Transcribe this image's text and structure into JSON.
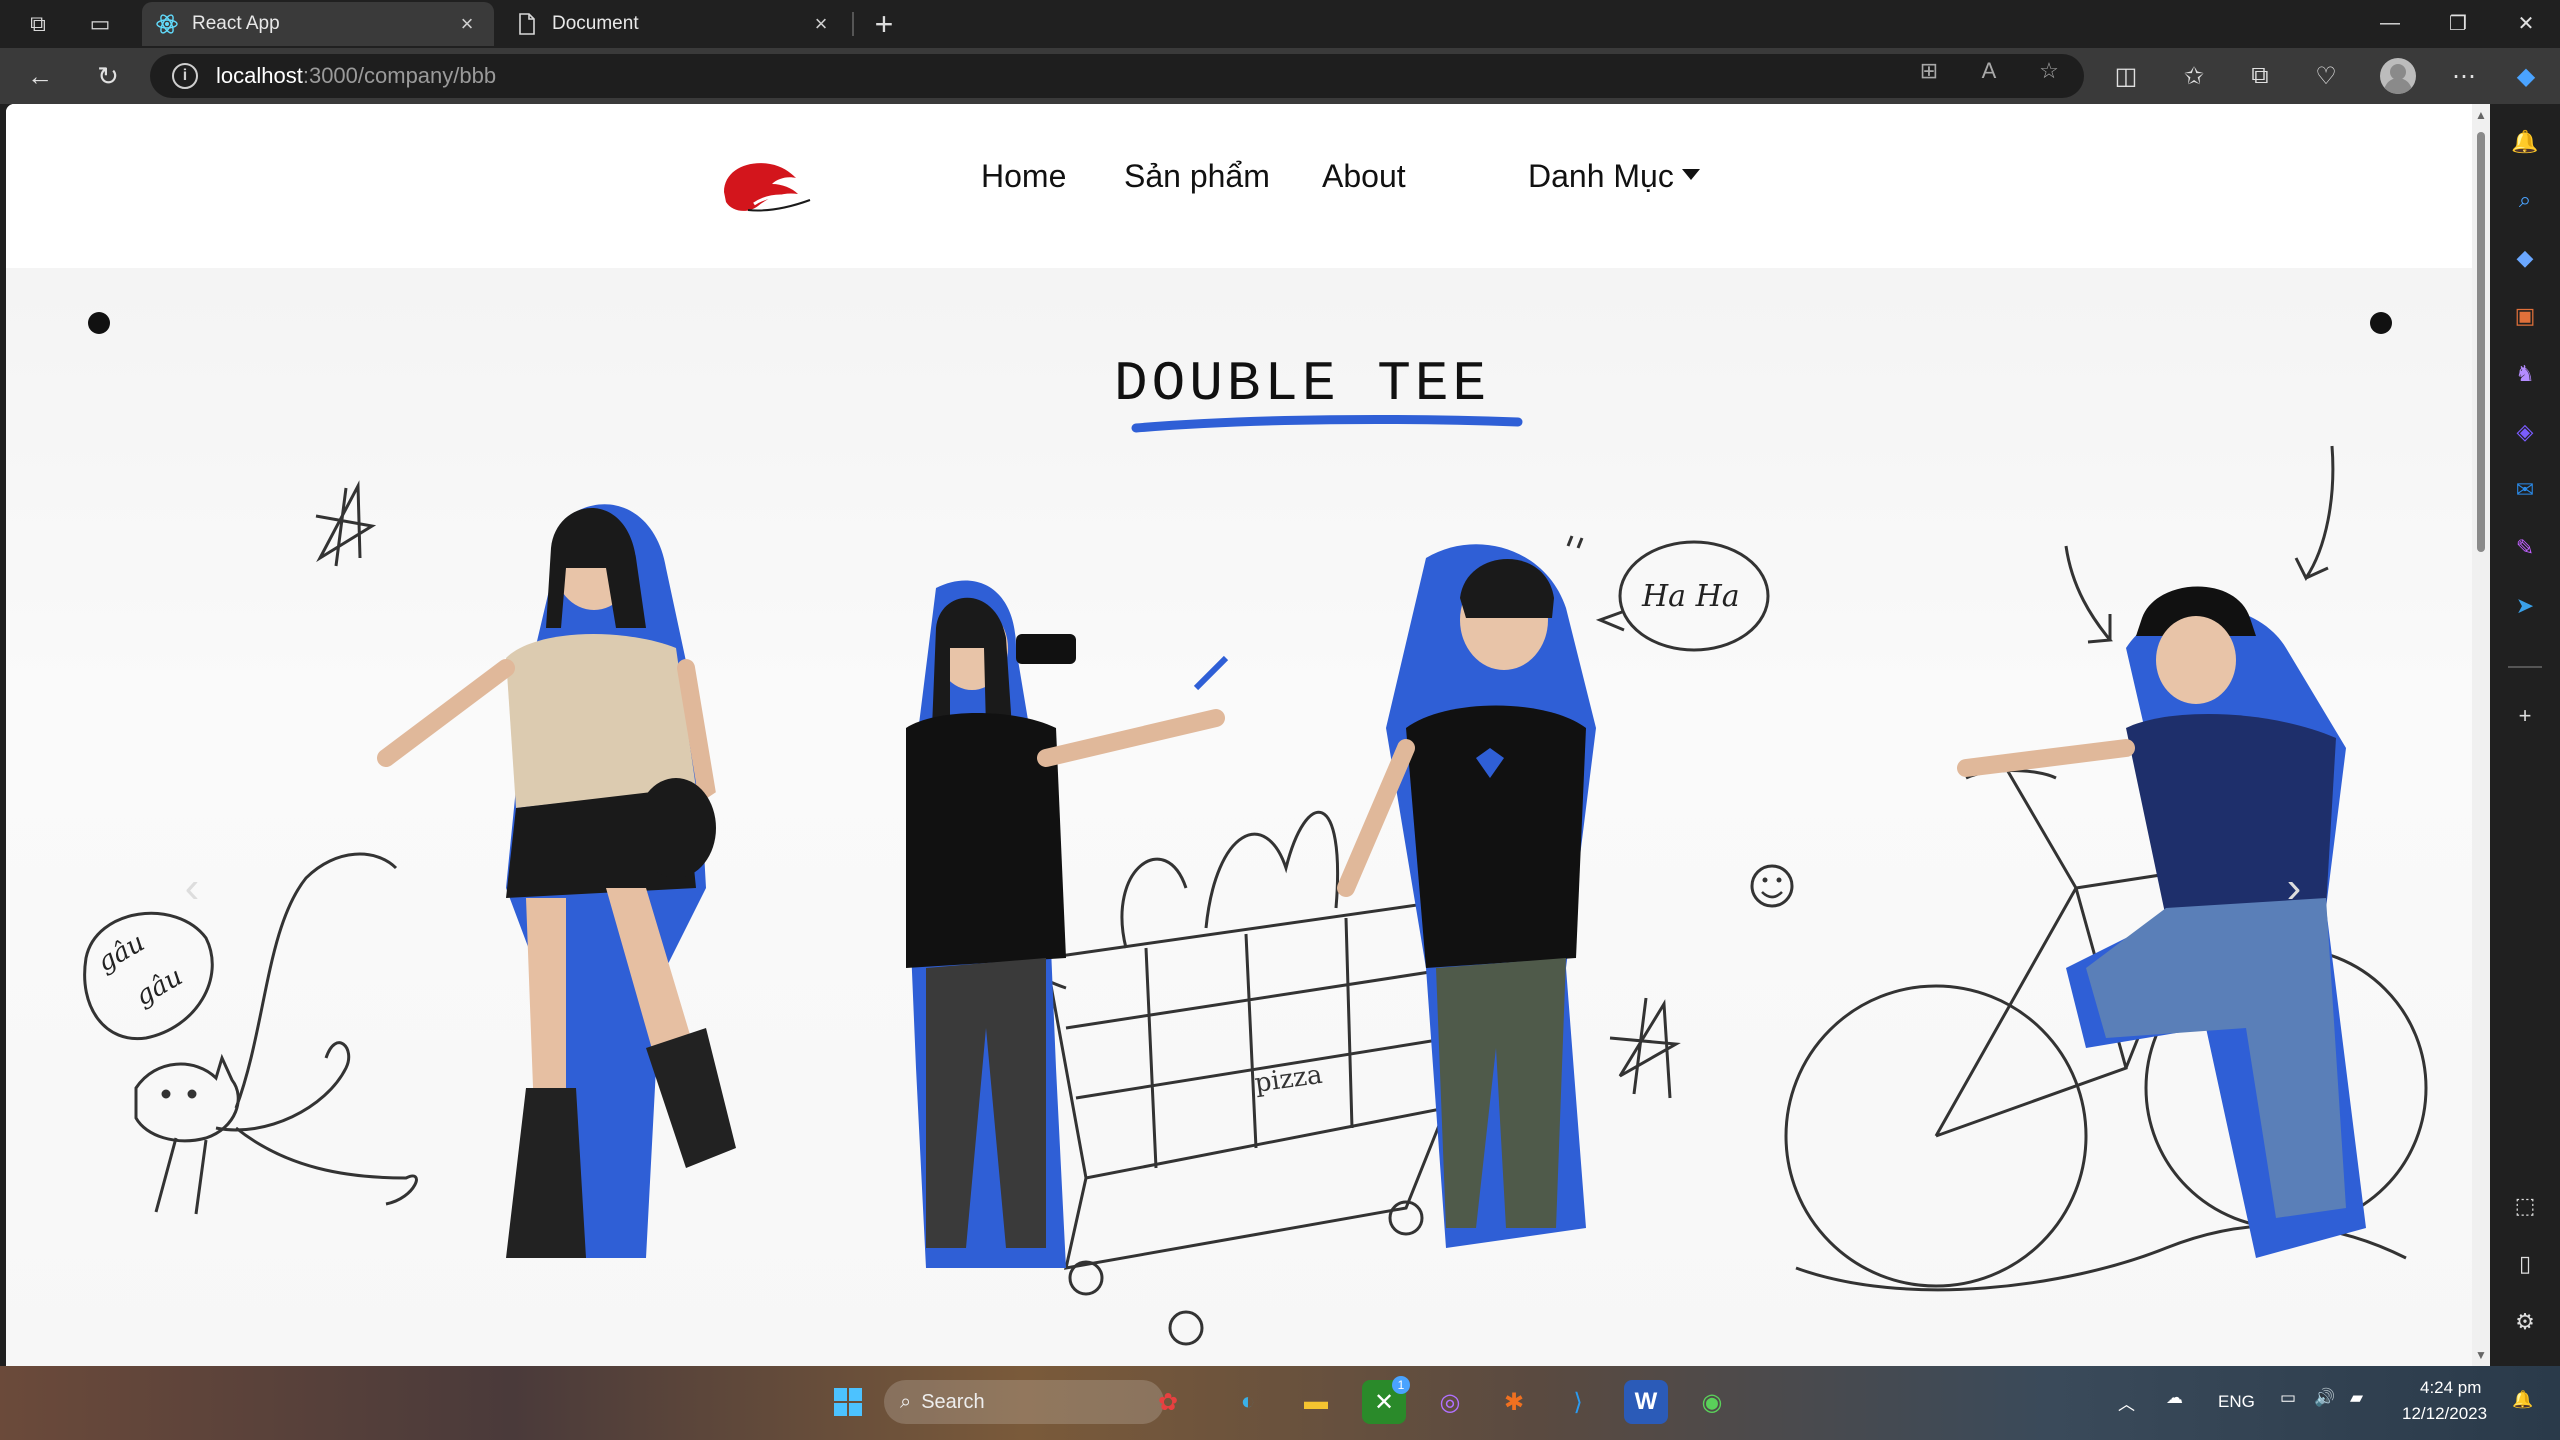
{
  "browser": {
    "tabs": [
      {
        "title": "React App",
        "active": true
      },
      {
        "title": "Document",
        "active": false
      }
    ],
    "url_host": "localhost",
    "url_path": ":3000/company/bbb"
  },
  "site": {
    "nav": {
      "home": "Home",
      "products": "Sản phẩm",
      "about": "About",
      "category": "Danh Mục"
    },
    "hero": {
      "title": "DOUBLE TEE",
      "doodle_haha": "Ha Ha",
      "doodle_gau1": "gâu",
      "doodle_gau2": "gâu",
      "doodle_pizza": "pizza"
    }
  },
  "taskbar": {
    "search_placeholder": "Search",
    "language": "ENG",
    "time": "4:24 pm",
    "date": "12/12/2023",
    "xbox_badge": "1"
  },
  "colors": {
    "accent_blue": "#2f5fd6",
    "logo_red": "#d3151c",
    "chrome_dark": "#202020",
    "chrome_mid": "#3a3a3a"
  }
}
